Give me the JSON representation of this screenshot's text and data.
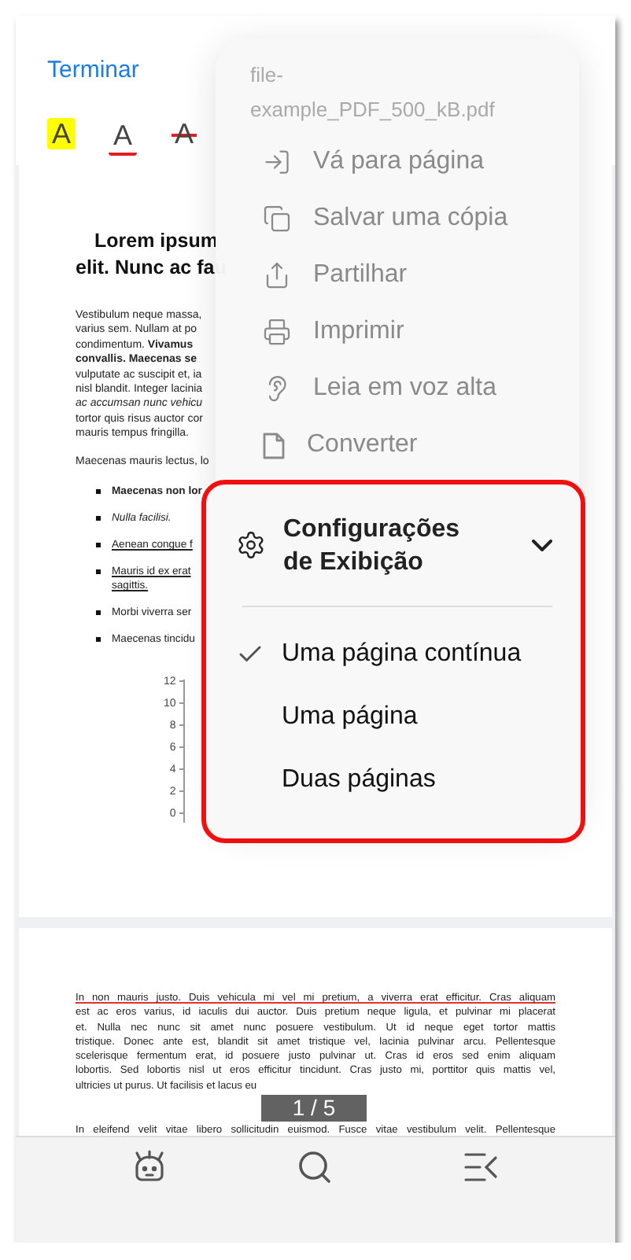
{
  "header": {
    "done_button": "Terminar"
  },
  "annotation_tools": [
    {
      "kind": "highlight",
      "letter": "A"
    },
    {
      "kind": "underline",
      "letter": "A"
    },
    {
      "kind": "strikethrough",
      "letter": "A"
    }
  ],
  "page_1": {
    "title": [
      "Lorem ipsum",
      "elit. Nunc ac fau"
    ],
    "paragraphs": [
      [
        "Vestibulum neque massa,",
        "varius sem. Nullam at po",
        "condimentum. **Vivamus**",
        "**convallis. Maecenas se**",
        "vulputate ac suscipit et, ia",
        "nisl blandit. Integer lacinia",
        "*ac accumsan nunc vehicu*",
        "tortor quis risus auctor cor",
        "mauris tempus fringilla."
      ],
      [
        "Maecenas mauris lectus, lo"
      ]
    ],
    "bullets": [
      {
        "text": "Maecenas non lor",
        "kind": "strong"
      },
      {
        "text": "Nulla facilisi.",
        "kind": "emphasis"
      },
      {
        "text": "Aenean congue f",
        "kind": "link"
      },
      {
        "text": "Mauris id ex erat",
        "kind": "link",
        "continuation": "sagittis."
      },
      {
        "text": "Morbi viverra ser",
        "kind": "normal"
      },
      {
        "text": "Maecenas tincidu",
        "kind": "normal"
      }
    ],
    "chart_axis_labels": [
      "12",
      "10",
      "8",
      "6",
      "4",
      "2",
      "0"
    ]
  },
  "page_2": {
    "paragraphs": [
      {
        "lines": [
          "In non mauris justo. Duis vehicula mi vel mi pretium, a viverra erat efficitur. Cras aliquam",
          "est ac eros varius, id iaculis dui auctor. Duis pretium neque ligula, et pulvinar mi placerat",
          "et. Nulla nec nunc sit amet nunc posuere vestibulum. Ut id neque eget tortor mattis",
          "tristique. Donec ante est, blandit sit amet tristique vel, lacinia pulvinar arcu. Pellentesque",
          "scelerisque fermentum erat, id posuere justo pulvinar ut. Cras id eros sed enim aliquam",
          "lobortis. Sed lobortis nisl ut eros efficitur tincidunt. Cras justo mi, porttitor quis mattis vel,",
          "ultricies ut purus. Ut facilisis et lacus eu"
        ],
        "underlined_first_line": true
      },
      {
        "lines": [
          "In eleifend velit vitae libero sollicitudin euismod. Fusce vitae vestibulum velit. Pellentesque"
        ],
        "underlined_first_line": false
      }
    ]
  },
  "page_indicator": "1 / 5",
  "menu": {
    "file_name": "file-\nexample_PDF_500_kB.pdf",
    "items": [
      {
        "kind": "go_to_page",
        "label": "Vá para página"
      },
      {
        "kind": "save_copy",
        "label": "Salvar uma cópia"
      },
      {
        "kind": "share",
        "label": "Partilhar"
      },
      {
        "kind": "print",
        "label": "Imprimir"
      },
      {
        "kind": "read_aloud",
        "label": "Leia em voz alta"
      },
      {
        "kind": "convert",
        "label": "Converter"
      }
    ]
  },
  "display_settings": {
    "title": "Configurações\nde Exibição",
    "expanded": true,
    "highlighted": true,
    "options": [
      {
        "label": "Uma página contínua",
        "selected": true
      },
      {
        "label": "Uma página",
        "selected": false
      },
      {
        "label": "Duas páginas",
        "selected": false
      }
    ]
  },
  "bottom_bar": [
    {
      "kind": "assistant"
    },
    {
      "kind": "search"
    },
    {
      "kind": "outline"
    }
  ]
}
